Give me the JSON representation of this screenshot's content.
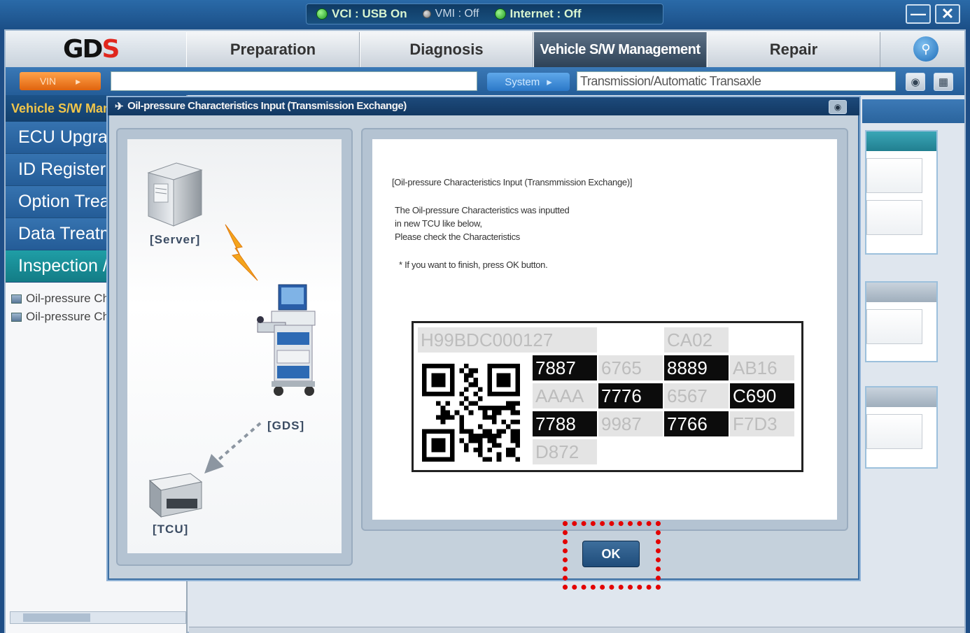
{
  "status": {
    "vci": "VCI : USB On",
    "vmi": "VMI : Off",
    "internet": "Internet : Off"
  },
  "window_controls": {
    "minimize": "—",
    "close": "✕"
  },
  "menu": {
    "tabs": [
      "Preparation",
      "Diagnosis",
      "Vehicle S/W Management",
      "Repair"
    ],
    "active_tab": "Vehicle S/W Management"
  },
  "toolbar": {
    "vin_button": "VIN",
    "vin_value": "",
    "system_button": "System",
    "system_value": "Transmission/Automatic Transaxle"
  },
  "sidebar": {
    "header": "Vehicle S/W Management",
    "items": [
      "ECU Upgrade",
      "ID Register",
      "Option Treatment",
      "Data Treatment",
      "Inspection / Test"
    ],
    "active_item": "Inspection / Test",
    "sub_items": [
      "Oil-pressure Characteristics Input",
      "Oil-pressure Characteristics Input"
    ]
  },
  "dialog": {
    "title": "Oil-pressure Characteristics Input (Transmission Exchange)",
    "server_label": "[Server]",
    "gds_label": "[GDS]",
    "tcu_label": "[TCU]",
    "message": {
      "heading": "[Oil-pressure Characteristics Input (Transmmission Exchange)]",
      "line1": "The Oil-pressure Characteristics was inputted",
      "line2": "in new TCU like below,",
      "line3": "Please check the Characteristics",
      "note": "* If you want to finish, press OK button."
    },
    "code_grid": {
      "part_no": "H99BDC000127",
      "suffix": "CA02",
      "cells": [
        {
          "text": "7887",
          "style": "dark"
        },
        {
          "text": "6765",
          "style": "light"
        },
        {
          "text": "8889",
          "style": "dark"
        },
        {
          "text": "AB16",
          "style": "light"
        },
        {
          "text": "AAAA",
          "style": "light"
        },
        {
          "text": "7776",
          "style": "dark"
        },
        {
          "text": "6567",
          "style": "light"
        },
        {
          "text": "C690",
          "style": "dark"
        },
        {
          "text": "7788",
          "style": "dark"
        },
        {
          "text": "9987",
          "style": "light"
        },
        {
          "text": "7766",
          "style": "dark"
        },
        {
          "text": "F7D3",
          "style": "light"
        },
        {
          "text": "D872",
          "style": "light"
        }
      ]
    },
    "ok_button": "OK"
  },
  "colors": {
    "frame_blue": "#1f4e86",
    "ok_highlight": "#e30000",
    "sidebar_header_text": "#f2c64a",
    "active_item": "#1f9ea6"
  }
}
